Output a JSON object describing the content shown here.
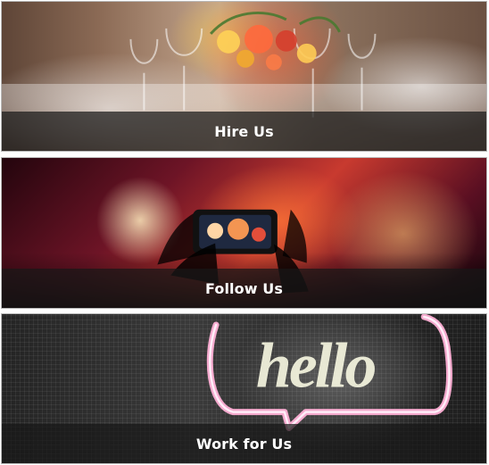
{
  "cards": [
    {
      "id": "card-hire",
      "label": "Hire Us"
    },
    {
      "id": "card-follow",
      "label": "Follow Us"
    },
    {
      "id": "card-work",
      "label": "Work for Us"
    }
  ],
  "neon_text": "hello"
}
